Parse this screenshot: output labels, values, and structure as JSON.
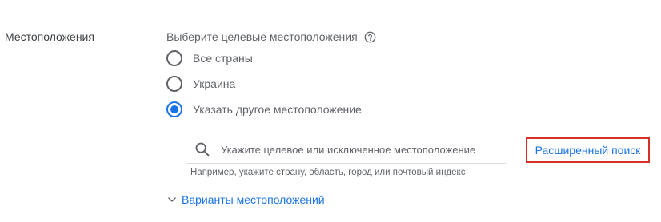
{
  "section": {
    "label": "Местоположения"
  },
  "prompt": {
    "text": "Выберите целевые местоположения",
    "help_icon": "help-circle-icon"
  },
  "radio_options": [
    {
      "label": "Все страны",
      "checked": false
    },
    {
      "label": "Украина",
      "checked": false
    },
    {
      "label": "Указать другое местоположение",
      "checked": true
    }
  ],
  "search": {
    "icon": "search-icon",
    "placeholder": "Укажите целевое или исключенное местоположение",
    "value": "",
    "hint": "Например, укажите страну, область, город или почтовый индекс"
  },
  "advanced_search": {
    "label": "Расширенный поиск",
    "highlight_color": "#d93025"
  },
  "location_options": {
    "label": "Варианты местоположений",
    "icon": "chevron-down-icon"
  },
  "colors": {
    "accent": "#1a73e8",
    "text": "#3c4043",
    "muted": "#5f6368"
  }
}
